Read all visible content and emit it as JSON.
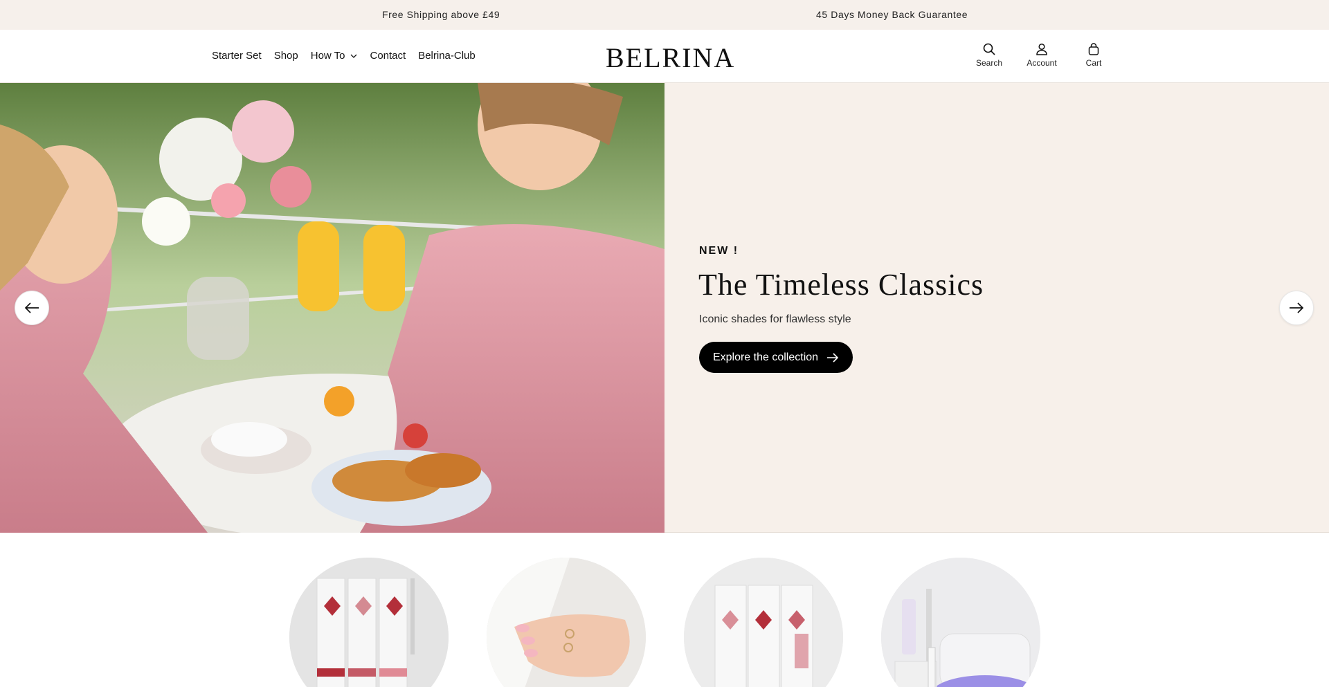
{
  "announcement": {
    "left": "Free Shipping above £49",
    "right": "45 Days Money Back Guarantee"
  },
  "header": {
    "logo": "BELRINA",
    "nav": [
      {
        "label": "Starter Set"
      },
      {
        "label": "Shop"
      },
      {
        "label": "How To",
        "has_dropdown": true
      },
      {
        "label": "Contact"
      },
      {
        "label": "Belrina-Club"
      }
    ],
    "actions": {
      "search": "Search",
      "account": "Account",
      "cart": "Cart"
    }
  },
  "hero": {
    "eyebrow": "NEW !",
    "title": "The Timeless Classics",
    "subtitle": "Iconic shades for flawless style",
    "cta": "Explore the collection",
    "image_icon": "brunch-photo",
    "prev_icon": "arrow-left-icon",
    "next_icon": "arrow-right-icon"
  },
  "categories": [
    {
      "image_icon": "gel-strips-kit-photo"
    },
    {
      "image_icon": "manicured-hand-photo"
    },
    {
      "image_icon": "gel-strips-packs-photo"
    },
    {
      "image_icon": "uv-lamp-kit-photo"
    }
  ],
  "colors": {
    "announcement_bg": "#f6f0eb",
    "hero_panel_bg": "#f7f0ea",
    "cta_bg": "#000000",
    "text": "#111111"
  }
}
